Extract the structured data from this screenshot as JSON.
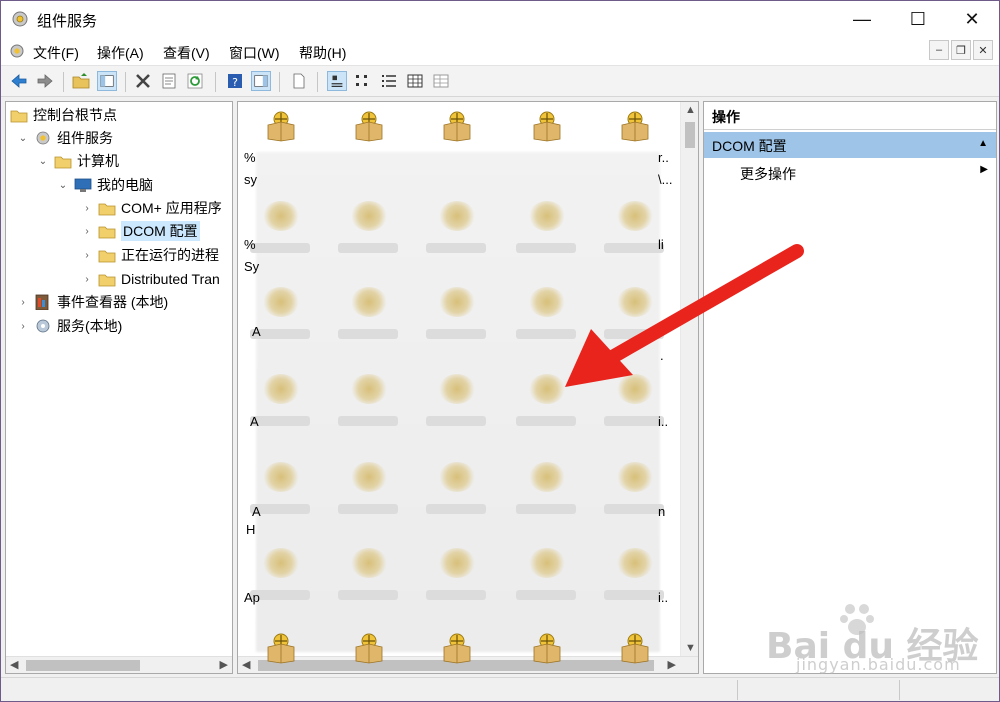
{
  "window": {
    "title": "组件服务",
    "minimize_glyph": "—",
    "maximize_glyph": "☐",
    "close_glyph": "✕"
  },
  "menu": {
    "items": [
      {
        "label": "文件(F)"
      },
      {
        "label": "操作(A)"
      },
      {
        "label": "查看(V)"
      },
      {
        "label": "窗口(W)"
      },
      {
        "label": "帮助(H)"
      }
    ],
    "mdi_minimize": "–",
    "mdi_restore": "❐",
    "mdi_close": "✕"
  },
  "tree": {
    "items": [
      {
        "label": "控制台根节点",
        "icon": "folder-icon",
        "arrow": ""
      },
      {
        "label": "组件服务",
        "icon": "component-services-icon",
        "arrow": "⌄"
      },
      {
        "label": "计算机",
        "icon": "folder-icon",
        "arrow": "⌄"
      },
      {
        "label": "我的电脑",
        "icon": "computer-icon",
        "arrow": "⌄"
      },
      {
        "label": "COM+ 应用程序",
        "icon": "folder-icon",
        "arrow": "›"
      },
      {
        "label": "DCOM 配置",
        "icon": "folder-icon",
        "arrow": "›"
      },
      {
        "label": "正在运行的进程",
        "icon": "folder-icon",
        "arrow": "›"
      },
      {
        "label": "Distributed Tran",
        "icon": "folder-icon",
        "arrow": "›"
      },
      {
        "label": "事件查看器 (本地)",
        "icon": "event-viewer-icon",
        "arrow": "›"
      },
      {
        "label": "服务(本地)",
        "icon": "services-icon",
        "arrow": "›"
      }
    ]
  },
  "grid": {
    "left_fragments": [
      "%",
      "sy",
      "%",
      "Sy",
      "A",
      "A",
      "A",
      "H",
      "Ap"
    ],
    "right_fragments": [
      "r..",
      "\\...",
      "li",
      ".",
      "i..",
      "n",
      "i.."
    ]
  },
  "actions": {
    "header": "操作",
    "section": "DCOM 配置",
    "more": "更多操作",
    "up_glyph": "▲",
    "more_glyph": "▶"
  },
  "watermark": {
    "brand": "Bai du 经验",
    "url": "jingyan.baidu.com"
  },
  "colors": {
    "selection": "#cce8ff",
    "action_section": "#9ec5e8",
    "arrow": "#e8241c"
  }
}
